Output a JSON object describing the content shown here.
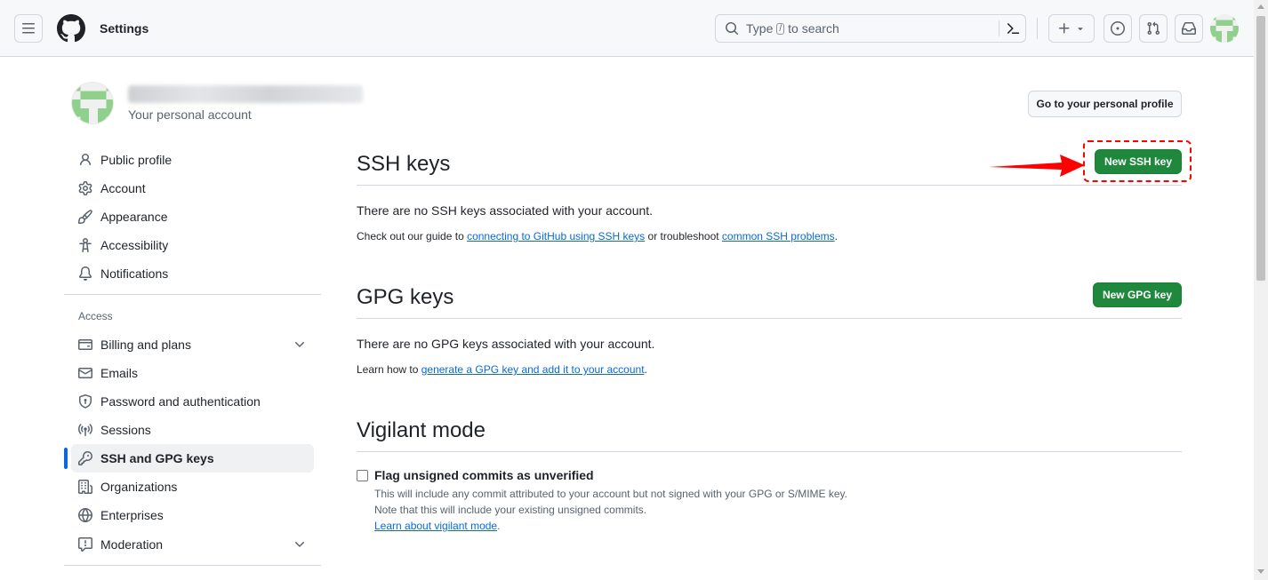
{
  "header": {
    "context_title": "Settings",
    "search_prefix": "Type",
    "search_key": "/",
    "search_suffix": "to search"
  },
  "account": {
    "subtitle": "Your personal account",
    "profile_button": "Go to your personal profile"
  },
  "sidebar": {
    "items": [
      {
        "label": "Public profile",
        "icon": "person-icon"
      },
      {
        "label": "Account",
        "icon": "gear-icon"
      },
      {
        "label": "Appearance",
        "icon": "paintbrush-icon"
      },
      {
        "label": "Accessibility",
        "icon": "accessibility-icon"
      },
      {
        "label": "Notifications",
        "icon": "bell-icon"
      }
    ],
    "access_heading": "Access",
    "access_items": [
      {
        "label": "Billing and plans",
        "icon": "credit-card-icon"
      },
      {
        "label": "Emails",
        "icon": "mail-icon"
      },
      {
        "label": "Password and authentication",
        "icon": "shield-lock-icon"
      },
      {
        "label": "Sessions",
        "icon": "broadcast-icon"
      },
      {
        "label": "SSH and GPG keys",
        "icon": "key-icon",
        "active": true
      },
      {
        "label": "Organizations",
        "icon": "organization-icon"
      },
      {
        "label": "Enterprises",
        "icon": "globe-icon"
      },
      {
        "label": "Moderation",
        "icon": "report-icon"
      }
    ]
  },
  "ssh": {
    "title": "SSH keys",
    "button": "New SSH key",
    "empty": "There are no SSH keys associated with your account.",
    "guide_prefix": "Check out our guide to ",
    "guide_link": "connecting to GitHub using SSH keys",
    "guide_middle": " or troubleshoot ",
    "guide_link2": "common SSH problems",
    "guide_suffix": "."
  },
  "gpg": {
    "title": "GPG keys",
    "button": "New GPG key",
    "empty": "There are no GPG keys associated with your account.",
    "learn_prefix": "Learn how to ",
    "learn_link": "generate a GPG key and add it to your account",
    "learn_suffix": "."
  },
  "vigilant": {
    "title": "Vigilant mode",
    "checkbox_label": "Flag unsigned commits as unverified",
    "desc_line1": "This will include any commit attributed to your account but not signed with your GPG or S/MIME key.",
    "desc_line2": "Note that this will include your existing unsigned commits.",
    "learn_link": "Learn about vigilant mode",
    "learn_suffix": "."
  },
  "colors": {
    "accent": "#0969da",
    "primary_button": "#1f883d",
    "annotation": "#ff0000"
  }
}
